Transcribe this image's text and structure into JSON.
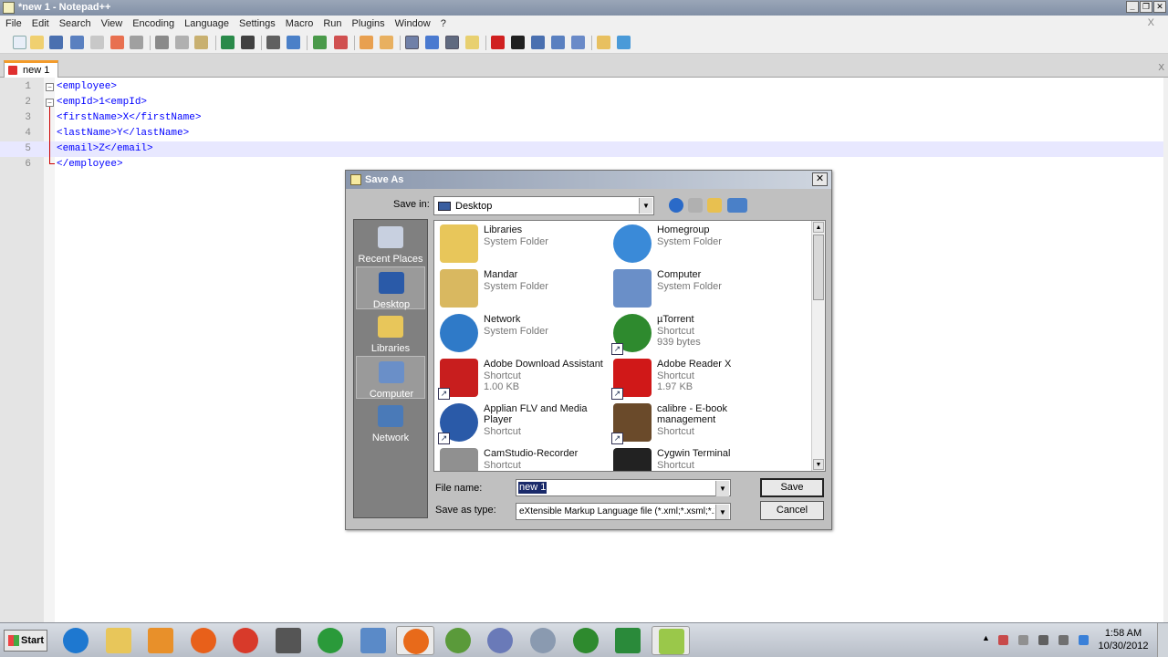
{
  "window": {
    "title": "*new  1 - Notepad++"
  },
  "menu": [
    "File",
    "Edit",
    "Search",
    "View",
    "Encoding",
    "Language",
    "Settings",
    "Macro",
    "Run",
    "Plugins",
    "Window",
    "?"
  ],
  "menu_close": "X",
  "tab": {
    "label": "new  1",
    "close": "X"
  },
  "editor": {
    "lines": [
      {
        "num": "1",
        "code": "<employee>"
      },
      {
        "num": "2",
        "code": "<empId>1<empId>"
      },
      {
        "num": "3",
        "code": "<firstName>X</firstName>"
      },
      {
        "num": "4",
        "code": "<lastName>Y</lastName>"
      },
      {
        "num": "5",
        "code": "<email>Z</email>"
      },
      {
        "num": "6",
        "code": "</employee>"
      }
    ],
    "active_line": 5
  },
  "dialog": {
    "title": "Save As",
    "close": "✕",
    "save_in_label": "Save in:",
    "save_in_value": "Desktop",
    "places": [
      {
        "label": "Recent Places",
        "icon": "recent-places-icon"
      },
      {
        "label": "Desktop",
        "icon": "desktop-icon"
      },
      {
        "label": "Libraries",
        "icon": "libraries-icon"
      },
      {
        "label": "Computer",
        "icon": "computer-icon"
      },
      {
        "label": "Network",
        "icon": "network-icon"
      }
    ],
    "selected_place": "Desktop",
    "files": [
      {
        "name": "Libraries",
        "sub1": "System Folder",
        "sub2": "",
        "icon": "libraries-folder-icon",
        "color": "#e8c65a",
        "shortcut": false
      },
      {
        "name": "Homegroup",
        "sub1": "System Folder",
        "sub2": "",
        "icon": "homegroup-icon",
        "color": "#3a8ad8",
        "shortcut": false
      },
      {
        "name": "Mandar",
        "sub1": "System Folder",
        "sub2": "",
        "icon": "user-folder-icon",
        "color": "#d9b860",
        "shortcut": false
      },
      {
        "name": "Computer",
        "sub1": "System Folder",
        "sub2": "",
        "icon": "computer-icon",
        "color": "#6a8fc8",
        "shortcut": false
      },
      {
        "name": "Network",
        "sub1": "System Folder",
        "sub2": "",
        "icon": "network-globe-icon",
        "color": "#2f7ac8",
        "shortcut": false
      },
      {
        "name": "µTorrent",
        "sub1": "Shortcut",
        "sub2": "939 bytes",
        "icon": "utorrent-icon",
        "color": "#2e8a2e",
        "shortcut": true
      },
      {
        "name": "Adobe Download Assistant",
        "sub1": "Shortcut",
        "sub2": "1.00 KB",
        "icon": "adobe-download-icon",
        "color": "#c81e1e",
        "shortcut": true
      },
      {
        "name": "Adobe Reader X",
        "sub1": "Shortcut",
        "sub2": "1.97 KB",
        "icon": "adobe-reader-icon",
        "color": "#d01818",
        "shortcut": true
      },
      {
        "name": "Applian FLV and Media Player",
        "sub1": "Shortcut",
        "sub2": "",
        "icon": "media-player-icon",
        "color": "#2a5aa8",
        "shortcut": true
      },
      {
        "name": "calibre - E-book management",
        "sub1": "Shortcut",
        "sub2": "",
        "icon": "calibre-icon",
        "color": "#6a4a2a",
        "shortcut": true
      },
      {
        "name": "CamStudio-Recorder",
        "sub1": "Shortcut",
        "sub2": "",
        "icon": "camstudio-icon",
        "color": "#909090",
        "shortcut": true
      },
      {
        "name": "Cygwin Terminal",
        "sub1": "Shortcut",
        "sub2": "",
        "icon": "cygwin-icon",
        "color": "#222222",
        "shortcut": true
      }
    ],
    "file_name_label": "File name:",
    "file_name_value": "new  1",
    "save_type_label": "Save as type:",
    "save_type_value": "eXtensible Markup Language file (*.xml;*.xsml;*.xsl;*.xslt)",
    "save_button": "Save",
    "cancel_button": "Cancel"
  },
  "taskbar": {
    "start_label": "Start",
    "items": [
      {
        "name": "internet-explorer-icon",
        "color": "#1e78d0"
      },
      {
        "name": "file-explorer-icon",
        "color": "#e8c65a"
      },
      {
        "name": "media-player-icon",
        "color": "#e8902a"
      },
      {
        "name": "firefox-icon",
        "color": "#e8601a"
      },
      {
        "name": "chrome-icon",
        "color": "#d83a2a"
      },
      {
        "name": "camera-icon",
        "color": "#555555"
      },
      {
        "name": "d-app-icon",
        "color": "#2a9a3a"
      },
      {
        "name": "network-tool-icon",
        "color": "#5a8ac8"
      },
      {
        "name": "w-app-icon",
        "color": "#e86a1a"
      },
      {
        "name": "frog-icon",
        "color": "#5a9a3a"
      },
      {
        "name": "r-app-icon",
        "color": "#6a7ab8"
      },
      {
        "name": "settings-gear-icon",
        "color": "#8a9ab0"
      },
      {
        "name": "utorrent-icon",
        "color": "#2e8a2e"
      },
      {
        "name": "excel-icon",
        "color": "#2a8a3a"
      },
      {
        "name": "notepadpp-icon",
        "color": "#9ac84a"
      }
    ],
    "clock_time": "1:58 AM",
    "clock_date": "10/30/2012"
  }
}
